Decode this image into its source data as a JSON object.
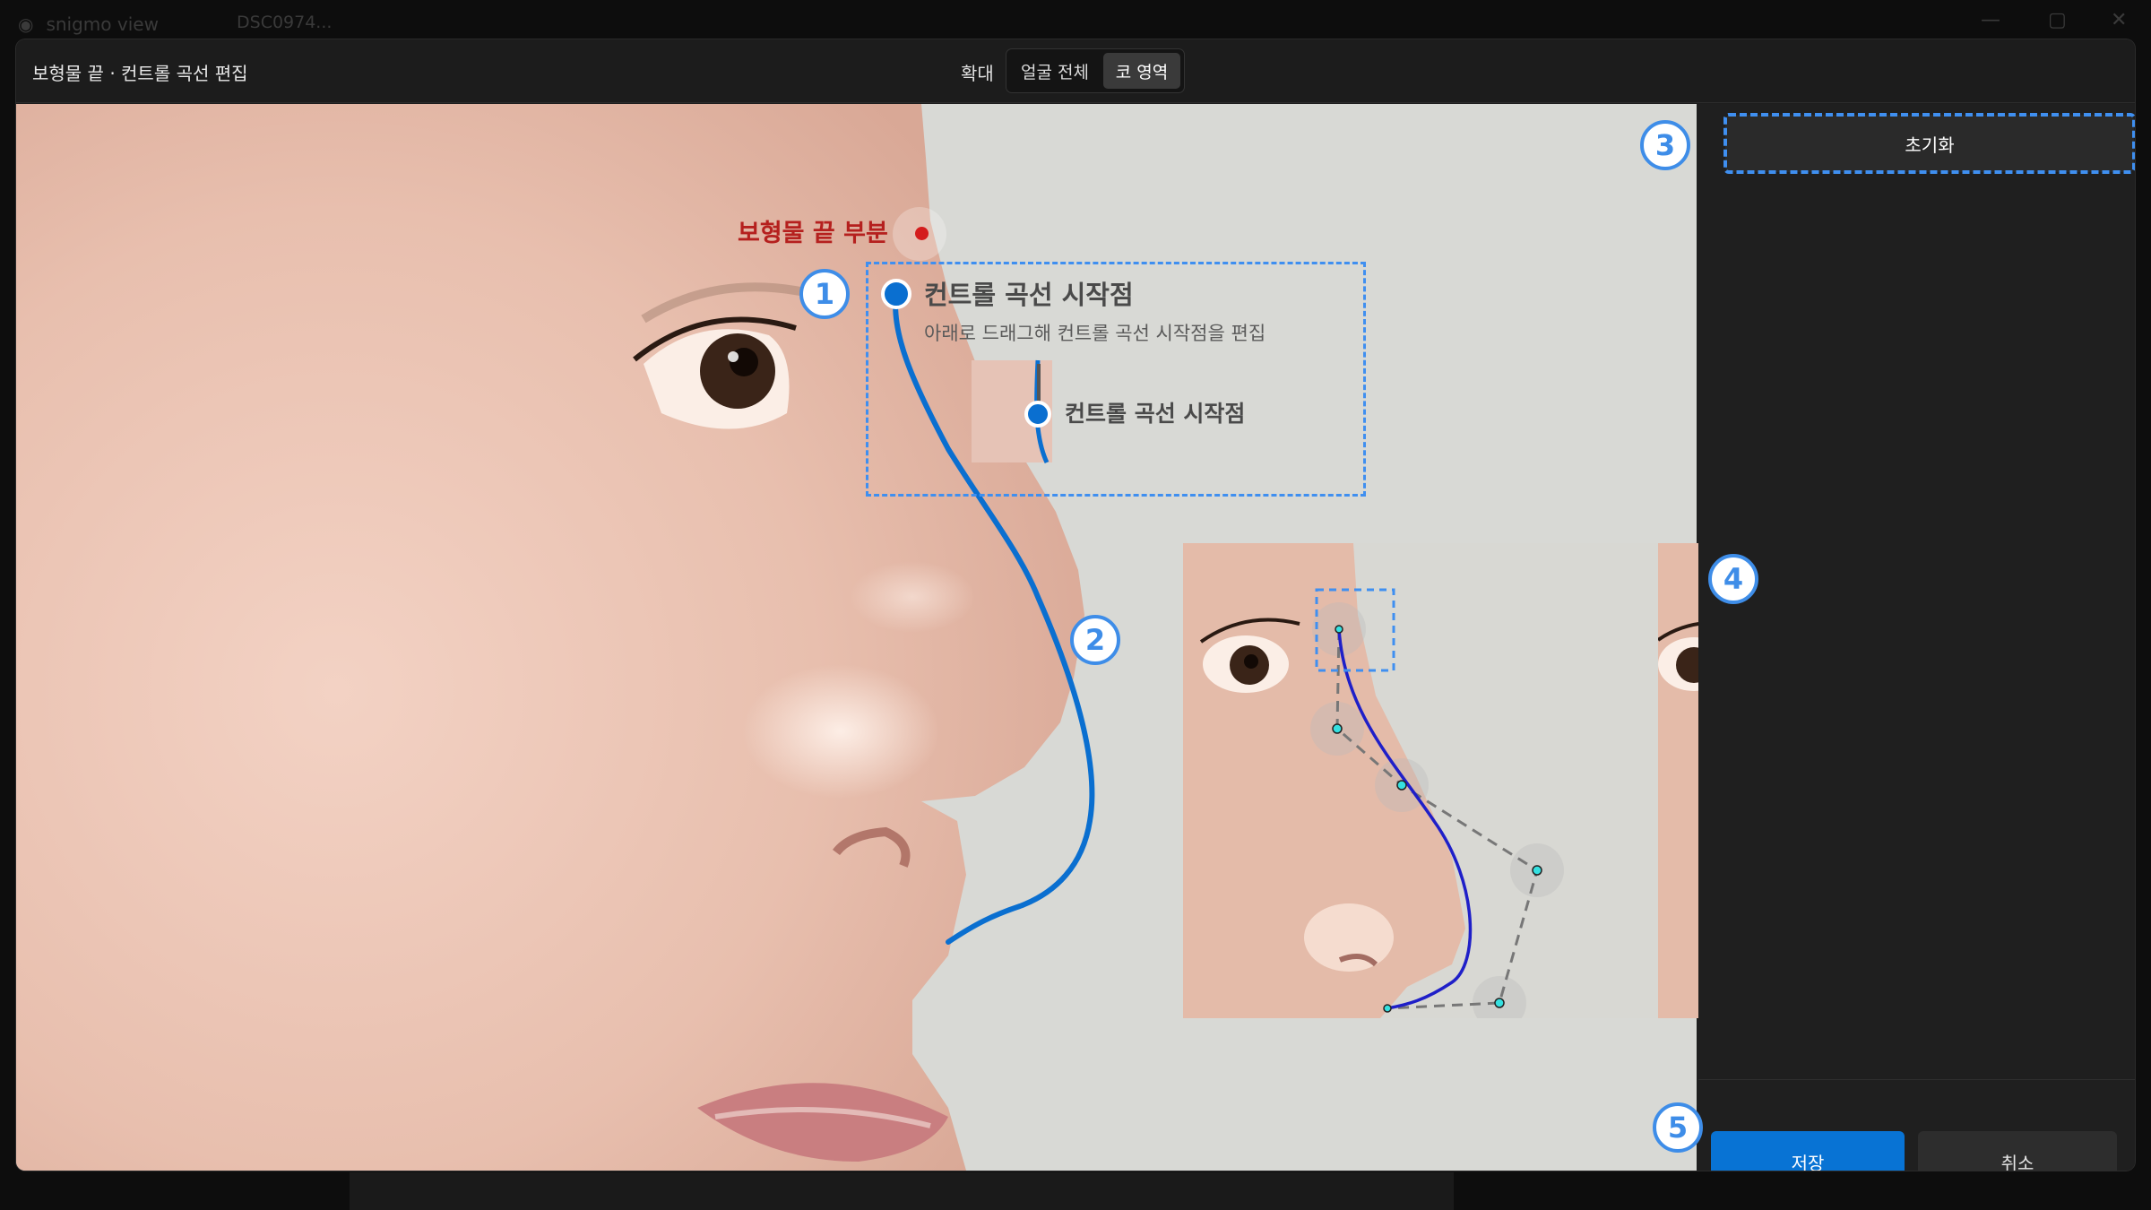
{
  "app": {
    "name": "snigmo view",
    "tab": "DSC0974..."
  },
  "dialog": {
    "title": "보형물 끝 · 컨트롤 곡선 편집"
  },
  "zoom": {
    "label": "확대",
    "options": [
      "얼굴 전체",
      "코 영역"
    ],
    "selected": "코 영역"
  },
  "annotations": {
    "implant_tip_label": "보형물 끝 부분",
    "callout_title": "컨트롤 곡선 시작점",
    "callout_sub": "아래로 드래그해 컨트롤 곡선 시작점을 편집",
    "mini_label": "컨트롤 곡선 시작점"
  },
  "badges": [
    "1",
    "2",
    "3",
    "4",
    "5"
  ],
  "sidebar": {
    "reset_label": "초기화"
  },
  "footer": {
    "save_label": "저장",
    "cancel_label": "취소"
  },
  "colors": {
    "accent": "#0873d4",
    "curve": "#0a6fd0",
    "dash": "#3f8ff0",
    "red_dot": "#d41c1c",
    "control_point": "#35e0e0"
  }
}
